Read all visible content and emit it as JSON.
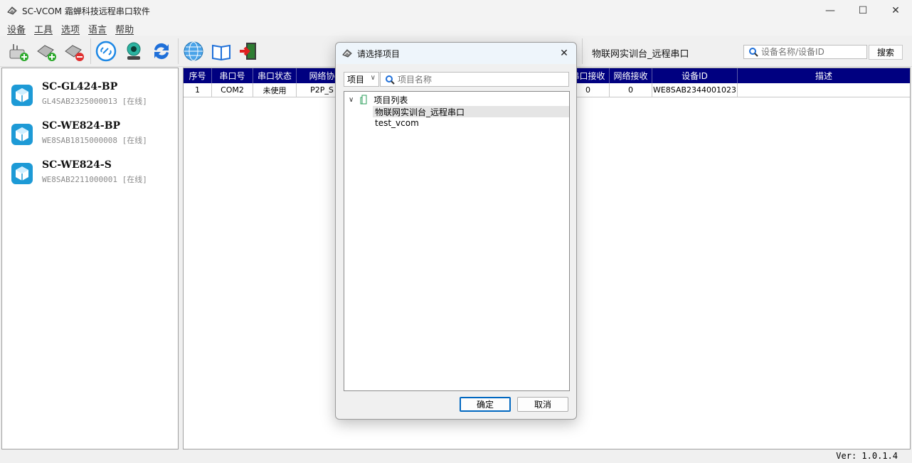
{
  "window": {
    "title": "SC-VCOM 霜蝉科技远程串口软件",
    "minimize": "—",
    "maximize": "☐",
    "close": "✕"
  },
  "menu": [
    "设备",
    "工具",
    "选项",
    "语言",
    "帮助"
  ],
  "toolbar": {
    "buttons": [
      "add-device-icon",
      "add-connection-icon",
      "remove-device-icon",
      "link-icon",
      "webcam-icon",
      "refresh-icon",
      "globe-icon",
      "manual-book-icon",
      "exit-icon"
    ],
    "project_label": "物联网实训台_远程串口",
    "search_placeholder": "设备名称/设备ID",
    "search_button": "搜索"
  },
  "devices": [
    {
      "name": "SC-GL424-BP",
      "id": "GL4SAB2325000013 [在线]"
    },
    {
      "name": "SC-WE824-BP",
      "id": "WE8SAB1815000008 [在线]"
    },
    {
      "name": "SC-WE824-S",
      "id": "WE8SAB2211000001 [在线]"
    }
  ],
  "table": {
    "columns": [
      "序号",
      "串口号",
      "串口状态",
      "网络协",
      "",
      "串口接收",
      "网络接收",
      "设备ID",
      "描述"
    ],
    "rows": [
      [
        "1",
        "COM2",
        "未使用",
        "P2P_S",
        "",
        "0",
        "0",
        "WE8SAB2344001023",
        ""
      ]
    ]
  },
  "status": {
    "version": "Ver: 1.0.1.4"
  },
  "dialog": {
    "title": "请选择项目",
    "close": "✕",
    "filter_select": "项目",
    "search_placeholder": "项目名称",
    "tree_root": "项目列表",
    "tree_items": [
      "物联网实训台_远程串口",
      "test_vcom"
    ],
    "ok": "确定",
    "cancel": "取消"
  },
  "colors": {
    "table_header": "#000080",
    "dialog_primary": "#0067c0"
  }
}
